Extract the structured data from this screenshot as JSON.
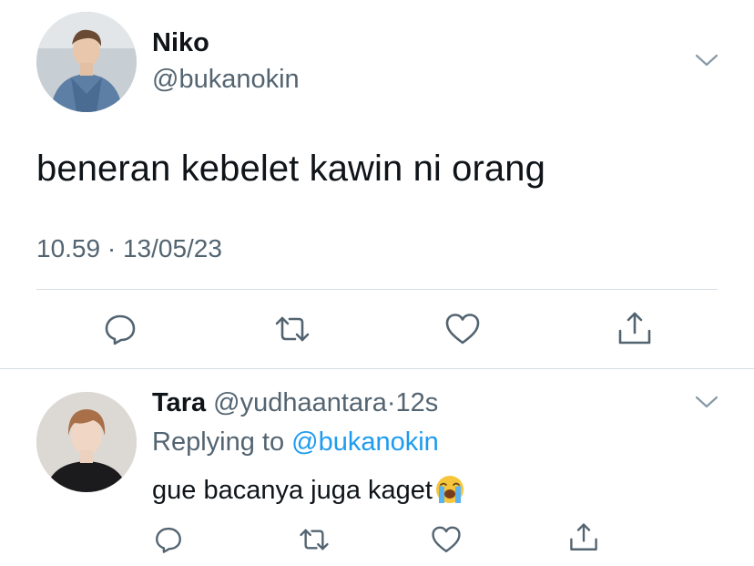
{
  "main_tweet": {
    "name": "Niko",
    "handle": "@bukanokin",
    "text": "beneran kebelet kawin ni orang",
    "timestamp": "10.59 · 13/05/23"
  },
  "reply_tweet": {
    "name": "Tara",
    "handle": "@yudhaantara",
    "separator": "·",
    "time": "12s",
    "replying_prefix": "Replying to",
    "replying_handle": "@bukanokin",
    "text": "gue bacanya juga kaget",
    "emoji": "loudly-crying-face"
  },
  "icons": {
    "reply": "speech-bubble-icon",
    "retweet": "retweet-icon",
    "like": "heart-icon",
    "share": "share-icon",
    "more": "chevron-down-icon"
  },
  "colors": {
    "text": "#0f1419",
    "secondary": "#536471",
    "link": "#1d9bf0",
    "divider": "#d8dee3"
  }
}
